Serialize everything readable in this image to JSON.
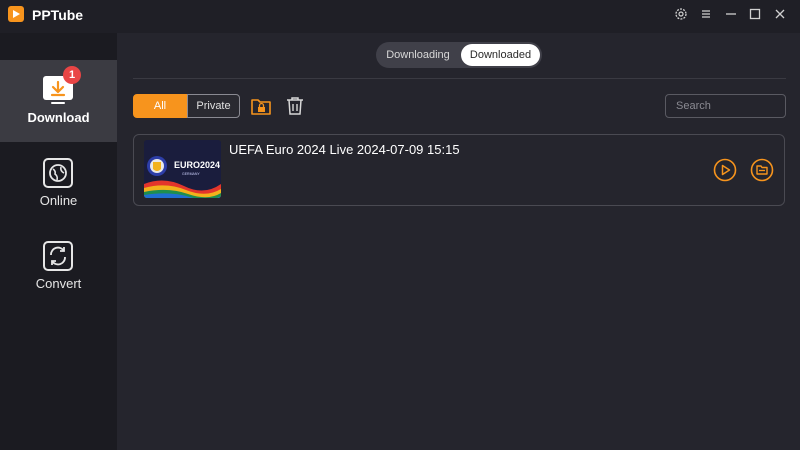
{
  "app": {
    "title": "PPTube"
  },
  "window_controls": [
    "gear-icon",
    "menu-icon",
    "minimize-icon",
    "maximize-icon",
    "close-icon"
  ],
  "sidebar": {
    "items": [
      {
        "label": "Download",
        "icon": "download-icon",
        "badge": "1",
        "active": true
      },
      {
        "label": "Online",
        "icon": "globe-icon"
      },
      {
        "label": "Convert",
        "icon": "convert-icon"
      }
    ]
  },
  "tabs": [
    {
      "label": "Downloading",
      "active": false
    },
    {
      "label": "Downloaded",
      "active": true
    }
  ],
  "filters": [
    {
      "label": "All",
      "active": true
    },
    {
      "label": "Private",
      "active": false
    }
  ],
  "toolbar": {
    "lock_icon": "folder-lock-icon",
    "delete_icon": "trash-icon"
  },
  "search": {
    "placeholder": "Search",
    "value": ""
  },
  "downloads": [
    {
      "title": "UEFA Euro 2024 Live 2024-07-09 15:15",
      "thumbnail_text": "EURO2024",
      "thumbnail_subtext": "GERMANY",
      "actions": [
        "play-icon",
        "open-folder-icon"
      ]
    }
  ],
  "colors": {
    "accent": "#f7941d",
    "badge": "#e94545",
    "background": "#25252d",
    "sidebar": "#1b1b21"
  }
}
